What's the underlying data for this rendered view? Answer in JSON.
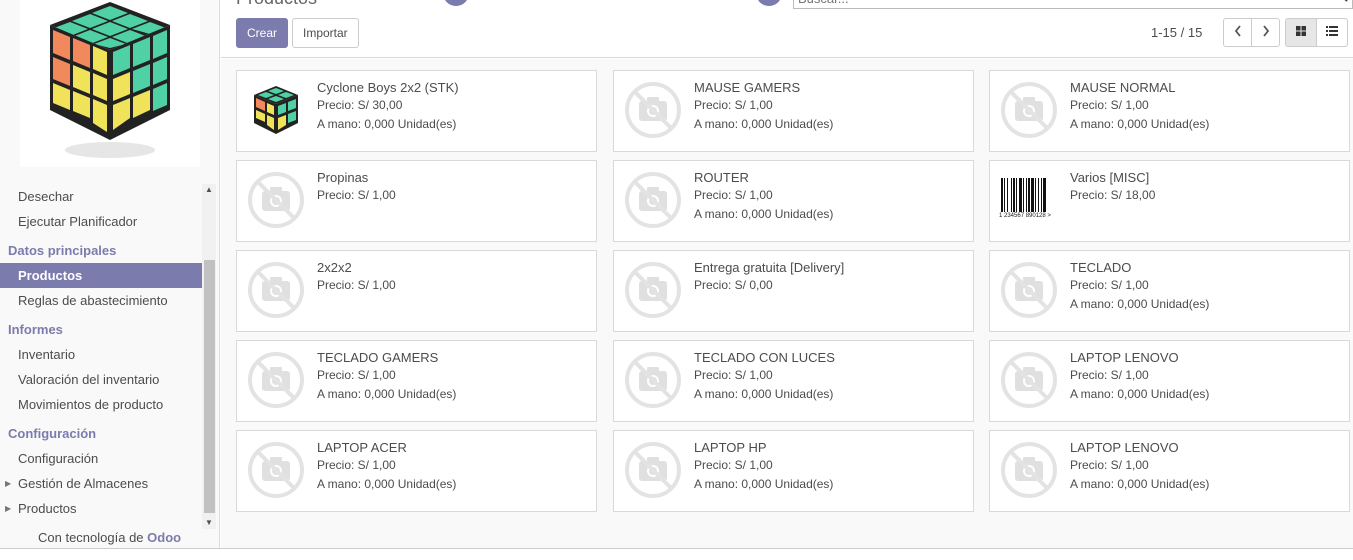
{
  "header": {
    "title": "Productos",
    "search_placeholder": "Buscar...",
    "create_label": "Crear",
    "import_label": "Importar",
    "pager": "1-15 / 15"
  },
  "sidebar": {
    "items": [
      {
        "type": "item",
        "label": "Desechar"
      },
      {
        "type": "item",
        "label": "Ejecutar Planificador"
      },
      {
        "type": "head",
        "label": "Datos principales"
      },
      {
        "type": "item",
        "label": "Productos",
        "active": true
      },
      {
        "type": "item",
        "label": "Reglas de abastecimiento"
      },
      {
        "type": "head",
        "label": "Informes"
      },
      {
        "type": "item",
        "label": "Inventario"
      },
      {
        "type": "item",
        "label": "Valoración del inventario"
      },
      {
        "type": "item",
        "label": "Movimientos de producto"
      },
      {
        "type": "head",
        "label": "Configuración"
      },
      {
        "type": "item",
        "label": "Configuración"
      },
      {
        "type": "item",
        "label": "Gestión de Almacenes",
        "caret": true
      },
      {
        "type": "item",
        "label": "Productos",
        "caret": true
      }
    ],
    "powered_prefix": "Con tecnología de ",
    "powered_brand": "Odoo"
  },
  "products": [
    {
      "name": "Cyclone Boys 2x2 (STK)",
      "price": "Precio: S/ 30,00",
      "stock": "A mano: 0,000 Unidad(es)",
      "image": "cube"
    },
    {
      "name": "MAUSE GAMERS",
      "price": "Precio: S/ 1,00",
      "stock": "A mano: 0,000 Unidad(es)",
      "image": "placeholder"
    },
    {
      "name": "MAUSE NORMAL",
      "price": "Precio: S/ 1,00",
      "stock": "A mano: 0,000 Unidad(es)",
      "image": "placeholder"
    },
    {
      "name": "Propinas",
      "price": "Precio: S/ 1,00",
      "stock": "",
      "image": "placeholder"
    },
    {
      "name": "ROUTER",
      "price": "Precio: S/ 1,00",
      "stock": "A mano: 0,000 Unidad(es)",
      "image": "placeholder"
    },
    {
      "name": "Varios [MISC]",
      "price": "Precio: S/ 18,00",
      "stock": "",
      "image": "barcode",
      "barcode_text": "1 234567 890128 >"
    },
    {
      "name": "2x2x2",
      "price": "Precio: S/ 1,00",
      "stock": "",
      "image": "placeholder"
    },
    {
      "name": "Entrega gratuita [Delivery]",
      "price": "Precio: S/ 0,00",
      "stock": "",
      "image": "placeholder"
    },
    {
      "name": "TECLADO",
      "price": "Precio: S/ 1,00",
      "stock": "A mano: 0,000 Unidad(es)",
      "image": "placeholder"
    },
    {
      "name": "TECLADO GAMERS",
      "price": "Precio: S/ 1,00",
      "stock": "A mano: 0,000 Unidad(es)",
      "image": "placeholder"
    },
    {
      "name": "TECLADO CON LUCES",
      "price": "Precio: S/ 1,00",
      "stock": "A mano: 0,000 Unidad(es)",
      "image": "placeholder"
    },
    {
      "name": "LAPTOP LENOVO",
      "price": "Precio: S/ 1,00",
      "stock": "A mano: 0,000 Unidad(es)",
      "image": "placeholder"
    },
    {
      "name": "LAPTOP ACER",
      "price": "Precio: S/ 1,00",
      "stock": "A mano: 0,000 Unidad(es)",
      "image": "placeholder"
    },
    {
      "name": "LAPTOP HP",
      "price": "Precio: S/ 1,00",
      "stock": "A mano: 0,000 Unidad(es)",
      "image": "placeholder"
    },
    {
      "name": "LAPTOP LENOVO",
      "price": "Precio: S/ 1,00",
      "stock": "A mano: 0,000 Unidad(es)",
      "image": "placeholder"
    }
  ],
  "colors": {
    "accent": "#7c7bad",
    "border": "#d9d9d9",
    "background": "#f9f9f9"
  }
}
